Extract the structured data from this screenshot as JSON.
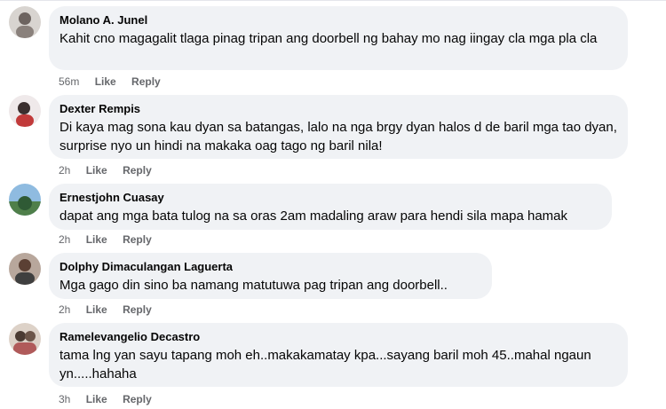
{
  "comments": [
    {
      "author": "Molano A. Junel",
      "text": "Kahit cno magagalit tlaga pinag tripan ang doorbell ng bahay mo nag iingay cla mga pla cla",
      "time": "56m",
      "like": "Like",
      "reply": "Reply"
    },
    {
      "author": "Dexter Rempis",
      "text": "Di kaya mag sona kau dyan sa batangas, lalo na nga brgy dyan halos d de baril mga tao dyan, surprise nyo un hindi na makaka oag tago ng baril nila!",
      "time": "2h",
      "like": "Like",
      "reply": "Reply"
    },
    {
      "author": "Ernestjohn Cuasay",
      "text": "dapat ang mga bata tulog na sa oras 2am madaling araw para hendi sila mapa hamak",
      "time": "2h",
      "like": "Like",
      "reply": "Reply"
    },
    {
      "author": "Dolphy Dimaculangan Laguerta",
      "text": "Mga gago din sino ba namang matutuwa pag tripan ang doorbell..",
      "time": "2h",
      "like": "Like",
      "reply": "Reply"
    },
    {
      "author": "Ramelevangelio Decastro",
      "text": "tama lng yan sayu tapang moh eh..makakamatay kpa...sayang baril moh 45..mahal ngaun yn.....hahaha",
      "time": "3h",
      "like": "Like",
      "reply": "Reply"
    }
  ]
}
